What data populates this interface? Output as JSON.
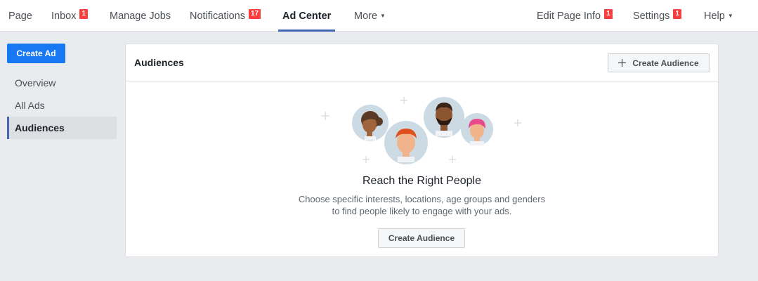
{
  "topnav": {
    "items": [
      {
        "label": "Page",
        "badge": ""
      },
      {
        "label": "Inbox",
        "badge": "1"
      },
      {
        "label": "Manage Jobs",
        "badge": ""
      },
      {
        "label": "Notifications",
        "badge": "17"
      },
      {
        "label": "Ad Center",
        "badge": ""
      },
      {
        "label": "More",
        "badge": ""
      }
    ],
    "right_items": [
      {
        "label": "Edit Page Info",
        "badge": "1"
      },
      {
        "label": "Settings",
        "badge": "1"
      },
      {
        "label": "Help",
        "badge": ""
      }
    ],
    "active": "Ad Center",
    "caret_icon": "caret-down-icon"
  },
  "sidebar": {
    "create_ad_label": "Create Ad",
    "items": [
      {
        "label": "Overview"
      },
      {
        "label": "All Ads"
      },
      {
        "label": "Audiences"
      }
    ],
    "active": "Audiences"
  },
  "panel": {
    "title": "Audiences",
    "header_button_label": "Create Audience",
    "header_button_icon": "plus-icon",
    "illustration": "people-avatars-illustration",
    "empty_title": "Reach the Right People",
    "empty_desc_line1": "Choose specific interests, locations, age groups and genders",
    "empty_desc_line2": "to find people likely to engage with your ads.",
    "cta_label": "Create Audience"
  },
  "colors": {
    "primary": "#1877f2",
    "active_underline": "#4267b2",
    "badge": "#fa3e3e",
    "page_bg": "#e9ebee"
  }
}
